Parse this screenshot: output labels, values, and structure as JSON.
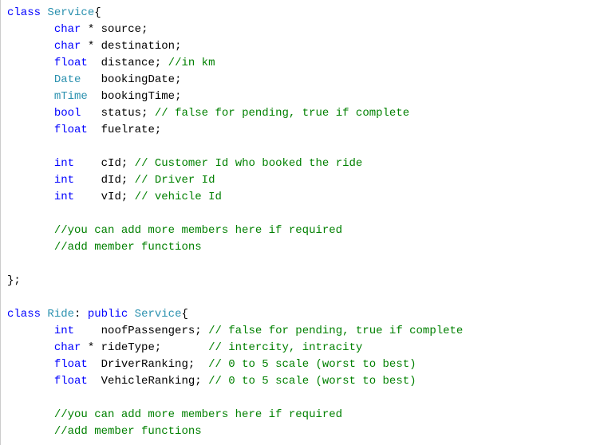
{
  "code": {
    "class1": {
      "keyword_class": "class",
      "name": "Service",
      "brace_open": "{",
      "fields": [
        {
          "indent": "       ",
          "type_class": "type-builtin",
          "type": "char",
          "ptr": " * ",
          "name": "source",
          "semi": ";",
          "comment": ""
        },
        {
          "indent": "       ",
          "type_class": "type-builtin",
          "type": "char",
          "ptr": " * ",
          "name": "destination",
          "semi": ";",
          "comment": ""
        },
        {
          "indent": "       ",
          "type_class": "type-builtin",
          "type": "float",
          "ptr": "  ",
          "name": "distance",
          "semi": "; ",
          "comment": "//in km"
        },
        {
          "indent": "       ",
          "type_class": "type-user",
          "type": "Date",
          "ptr": "   ",
          "name": "bookingDate",
          "semi": ";",
          "comment": ""
        },
        {
          "indent": "       ",
          "type_class": "type-user",
          "type": "mTime",
          "ptr": "  ",
          "name": "bookingTime",
          "semi": ";",
          "comment": ""
        },
        {
          "indent": "       ",
          "type_class": "type-builtin",
          "type": "bool",
          "ptr": "   ",
          "name": "status",
          "semi": "; ",
          "comment": "// false for pending, true if complete"
        },
        {
          "indent": "       ",
          "type_class": "type-builtin",
          "type": "float",
          "ptr": "  ",
          "name": "fuelrate",
          "semi": ";",
          "comment": ""
        }
      ],
      "fields2": [
        {
          "indent": "       ",
          "type_class": "type-builtin",
          "type": "int",
          "ptr": "    ",
          "name": "cId",
          "semi": "; ",
          "comment": "// Customer Id who booked the ride"
        },
        {
          "indent": "       ",
          "type_class": "type-builtin",
          "type": "int",
          "ptr": "    ",
          "name": "dId",
          "semi": "; ",
          "comment": "// Driver Id"
        },
        {
          "indent": "       ",
          "type_class": "type-builtin",
          "type": "int",
          "ptr": "    ",
          "name": "vId",
          "semi": "; ",
          "comment": "// vehicle Id"
        }
      ],
      "comments_tail": [
        "       //you can add more members here if required",
        "       //add member functions"
      ],
      "brace_close": "};"
    },
    "class2": {
      "keyword_class": "class",
      "name": "Ride",
      "colon": ":",
      "access": "public",
      "base": "Service",
      "brace_open": "{",
      "fields": [
        {
          "indent": "       ",
          "type_class": "type-builtin",
          "type": "int",
          "ptr": "    ",
          "name": "noofPassengers",
          "semi": "; ",
          "comment": "// false for pending, true if complete"
        },
        {
          "indent": "       ",
          "type_class": "type-builtin",
          "type": "char",
          "ptr": " * ",
          "name": "rideType",
          "semi": ";       ",
          "comment": "// intercity, intracity"
        },
        {
          "indent": "       ",
          "type_class": "type-builtin",
          "type": "float",
          "ptr": "  ",
          "name": "DriverRanking",
          "semi": ";  ",
          "comment": "// 0 to 5 scale (worst to best)"
        },
        {
          "indent": "       ",
          "type_class": "type-builtin",
          "type": "float",
          "ptr": "  ",
          "name": "VehicleRanking",
          "semi": "; ",
          "comment": "// 0 to 5 scale (worst to best)"
        }
      ],
      "comments_tail": [
        "       //you can add more members here if required",
        "       //add member functions"
      ]
    }
  }
}
